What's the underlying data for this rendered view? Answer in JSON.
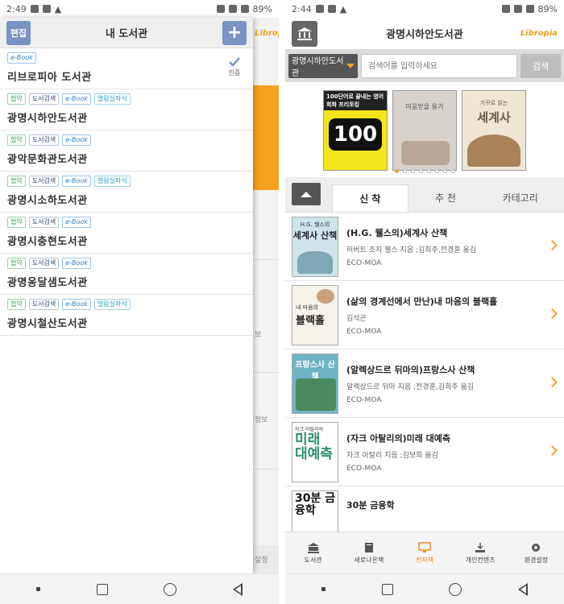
{
  "status_left": {
    "time": "2:49"
  },
  "status_right": {
    "time": "2:44"
  },
  "battery": "89%",
  "drawer": {
    "edit_label": "편집",
    "title": "내 도서관",
    "add_label": "+",
    "libraries": [
      {
        "name": "리브로피아 도서관",
        "tags": [
          {
            "label": "e-Book",
            "style": "blue"
          }
        ],
        "certified": true,
        "cert_label": "인증"
      },
      {
        "name": "광명시하안도서관",
        "tags": [
          {
            "label": "협약",
            "style": "green"
          },
          {
            "label": "도서검색",
            "style": "gray"
          },
          {
            "label": "e-Book",
            "style": "blue"
          },
          {
            "label": "열람실좌석",
            "style": "cyan"
          }
        ]
      },
      {
        "name": "광악문화관도서관",
        "tags": [
          {
            "label": "협약",
            "style": "green"
          },
          {
            "label": "도서검색",
            "style": "gray"
          },
          {
            "label": "e-Book",
            "style": "blue"
          }
        ]
      },
      {
        "name": "광명시소하도서관",
        "tags": [
          {
            "label": "협약",
            "style": "green"
          },
          {
            "label": "도서검색",
            "style": "gray"
          },
          {
            "label": "e-Book",
            "style": "blue"
          },
          {
            "label": "열람실좌석",
            "style": "cyan"
          }
        ]
      },
      {
        "name": "광명시충현도서관",
        "tags": [
          {
            "label": "협약",
            "style": "green"
          },
          {
            "label": "도서검색",
            "style": "gray"
          },
          {
            "label": "e-Book",
            "style": "blue"
          }
        ]
      },
      {
        "name": "광명옹달샘도서관",
        "tags": [
          {
            "label": "협약",
            "style": "green"
          },
          {
            "label": "도서검색",
            "style": "gray"
          },
          {
            "label": "e-Book",
            "style": "blue"
          }
        ]
      },
      {
        "name": "광명시철산도서관",
        "tags": [
          {
            "label": "협약",
            "style": "green"
          },
          {
            "label": "도서검색",
            "style": "gray"
          },
          {
            "label": "e-Book",
            "style": "blue"
          },
          {
            "label": "열람실좌석",
            "style": "cyan"
          }
        ]
      }
    ]
  },
  "bg_app": {
    "brand": "Libropia",
    "side_labels": [
      "보",
      "정보",
      "설정"
    ]
  },
  "app": {
    "title": "광명시하안도서관",
    "brand": "Libropia",
    "search": {
      "library_select": "광명시하안도서관",
      "placeholder": "검색어를 입력하세요",
      "button": "검색"
    },
    "banners": [
      {
        "top_text": "100단어로 끝내는 영어회화 프리토킹",
        "big": "100"
      },
      {
        "title": "미움받을 용기"
      },
      {
        "sub": "거꾸로 읽는",
        "big": "세계사"
      }
    ],
    "carousel_dots": 8,
    "tabs": [
      "신 착",
      "추 천",
      "카테고리"
    ],
    "books": [
      {
        "title": "(H.G. 웰스의)세계사 산책",
        "author": "허버트 조지 웰스 지음 ;김희주,전경훈 옮김",
        "source": "ECO-MOA",
        "cover_top": "H.G. 웰스의",
        "cover_big": "세계사 산책"
      },
      {
        "title": "(삶의 경계선에서 만난)내 마음의 블랙홀",
        "author": "김석곤",
        "source": "ECO-MOA",
        "cover_top": "내 마음의",
        "cover_big": "블랙홀"
      },
      {
        "title": "(알렉상드르 뒤마의)프랑스사 산책",
        "author": "알렉상드르 뒤마 지음 ;전경훈,김희주 옮김",
        "source": "ECO-MOA",
        "cover_big": "프랑스사 산책"
      },
      {
        "title": "(자크 아탈리의)미래 대예측",
        "author": "자크 아탈리 지음 ;김보희 옮김",
        "source": "ECO-MOA",
        "cover_top": "자크 아탈리의",
        "cover_big": "미래",
        "cover_big2": "대예측"
      },
      {
        "title": "30분 금융학",
        "cover_big": "30분 금융학"
      }
    ],
    "menu": [
      {
        "label": "도서관",
        "icon": "library-icon"
      },
      {
        "label": "새로나온책",
        "icon": "new-book-icon"
      },
      {
        "label": "전자책",
        "icon": "ebook-icon",
        "active": true
      },
      {
        "label": "개인컨텐츠",
        "icon": "download-icon"
      },
      {
        "label": "환경설정",
        "icon": "gear-icon"
      }
    ]
  },
  "colors": {
    "accent": "#f2a22c",
    "header_btn": "#7a93c4",
    "dark_btn": "#555555"
  }
}
